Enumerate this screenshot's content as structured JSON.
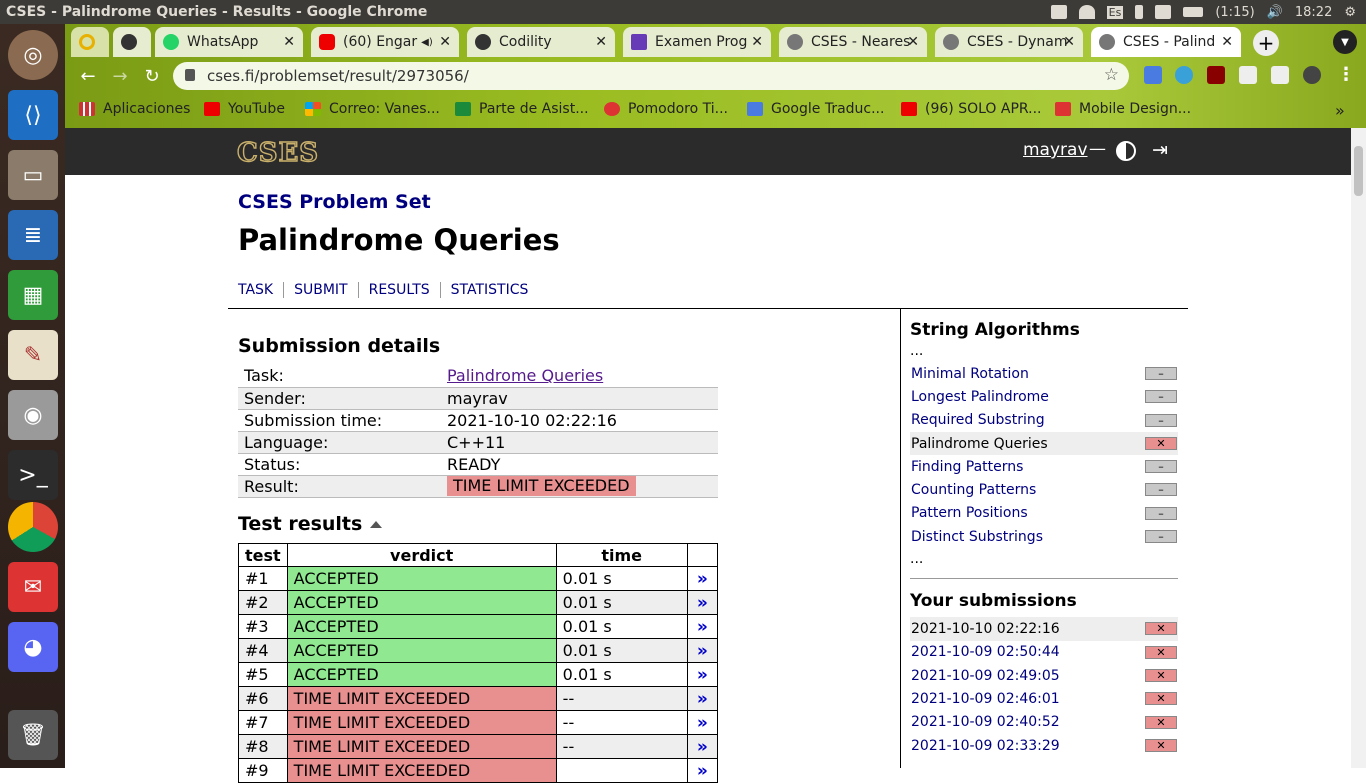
{
  "window_title": "CSES - Palindrome Queries - Results - Google Chrome",
  "tray": {
    "lang": "Es",
    "battery": "(1:15)",
    "time": "18:22"
  },
  "tabs": [
    {
      "label": "",
      "active": false
    },
    {
      "label": "",
      "active": false
    },
    {
      "label": "WhatsApp",
      "active": false
    },
    {
      "label": "(60) Engar",
      "active": false
    },
    {
      "label": "Codility",
      "active": false
    },
    {
      "label": "Examen Prog",
      "active": false
    },
    {
      "label": "CSES - Neares",
      "active": false
    },
    {
      "label": "CSES - Dynam",
      "active": false
    },
    {
      "label": "CSES - Palind",
      "active": true
    }
  ],
  "url": "cses.fi/problemset/result/2973056/",
  "bookmarks": [
    "Aplicaciones",
    "YouTube",
    "Correo: Vanes...",
    "Parte de Asist...",
    "Pomodoro Ti...",
    "Google Traduc...",
    "(96) SOLO APR...",
    "Mobile Design..."
  ],
  "bookmarks_more": "»",
  "cses": {
    "logo": "CSES",
    "username": "mayrav",
    "dash": "—"
  },
  "page": {
    "breadcrumb": "CSES Problem Set",
    "title": "Palindrome Queries",
    "nav": [
      "TASK",
      "SUBMIT",
      "RESULTS",
      "STATISTICS"
    ],
    "submission_heading": "Submission details",
    "details": [
      {
        "k": "Task:",
        "v": "Palindrome Queries"
      },
      {
        "k": "Sender:",
        "v": "mayrav"
      },
      {
        "k": "Submission time:",
        "v": "2021-10-10 02:22:16"
      },
      {
        "k": "Language:",
        "v": "C++11"
      },
      {
        "k": "Status:",
        "v": "READY"
      },
      {
        "k": "Result:",
        "v": "TIME LIMIT EXCEEDED"
      }
    ],
    "tests_heading": "Test results",
    "tests_cols": [
      "test",
      "verdict",
      "time"
    ],
    "tests": [
      {
        "test": "#1",
        "verdict": "ACCEPTED",
        "time": "0.01 s"
      },
      {
        "test": "#2",
        "verdict": "ACCEPTED",
        "time": "0.01 s"
      },
      {
        "test": "#3",
        "verdict": "ACCEPTED",
        "time": "0.01 s"
      },
      {
        "test": "#4",
        "verdict": "ACCEPTED",
        "time": "0.01 s"
      },
      {
        "test": "#5",
        "verdict": "ACCEPTED",
        "time": "0.01 s"
      },
      {
        "test": "#6",
        "verdict": "TIME LIMIT EXCEEDED",
        "time": "--"
      },
      {
        "test": "#7",
        "verdict": "TIME LIMIT EXCEEDED",
        "time": "--"
      },
      {
        "test": "#8",
        "verdict": "TIME LIMIT EXCEEDED",
        "time": "--"
      },
      {
        "test": "#9",
        "verdict": "TIME LIMIT EXCEEDED",
        "time": ""
      }
    ],
    "link_glyph": "»"
  },
  "sidebar": {
    "section_title": "String Algorithms",
    "ellipsis": "...",
    "problems": [
      {
        "name": "Minimal Rotation",
        "status": "–",
        "current": false,
        "bad": false
      },
      {
        "name": "Longest Palindrome",
        "status": "–",
        "current": false,
        "bad": false
      },
      {
        "name": "Required Substring",
        "status": "–",
        "current": false,
        "bad": false
      },
      {
        "name": "Palindrome Queries",
        "status": "✕",
        "current": true,
        "bad": true
      },
      {
        "name": "Finding Patterns",
        "status": "–",
        "current": false,
        "bad": false
      },
      {
        "name": "Counting Patterns",
        "status": "–",
        "current": false,
        "bad": false
      },
      {
        "name": "Pattern Positions",
        "status": "–",
        "current": false,
        "bad": false
      },
      {
        "name": "Distinct Substrings",
        "status": "–",
        "current": false,
        "bad": false
      }
    ],
    "submissions_title": "Your submissions",
    "submissions": [
      {
        "time": "2021-10-10 02:22:16",
        "status": "✕",
        "current": true
      },
      {
        "time": "2021-10-09 02:50:44",
        "status": "✕",
        "current": false
      },
      {
        "time": "2021-10-09 02:49:05",
        "status": "✕",
        "current": false
      },
      {
        "time": "2021-10-09 02:46:01",
        "status": "✕",
        "current": false
      },
      {
        "time": "2021-10-09 02:40:52",
        "status": "✕",
        "current": false
      },
      {
        "time": "2021-10-09 02:33:29",
        "status": "✕",
        "current": false
      }
    ]
  }
}
